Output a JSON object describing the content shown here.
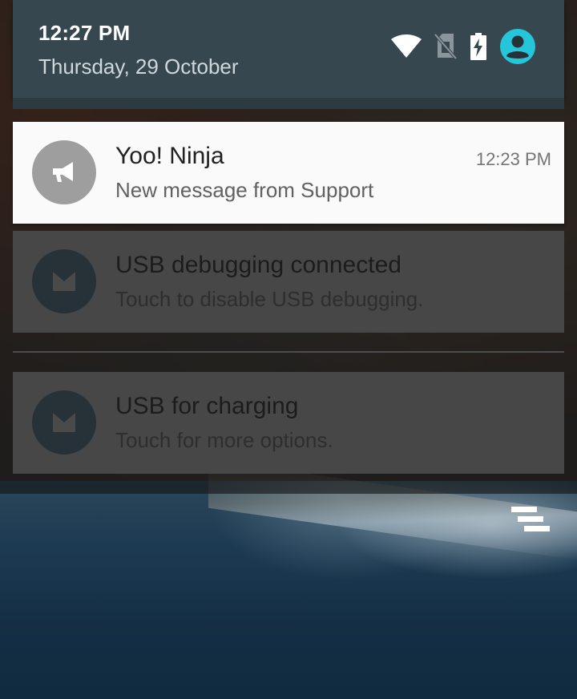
{
  "status": {
    "time": "12:27 PM",
    "date": "Thursday, 29 October",
    "icons": [
      "wifi-icon",
      "no-sim-icon",
      "battery-charging-icon",
      "account-icon"
    ],
    "colors": {
      "header_bg": "#37474f",
      "account_accent": "#26c6da"
    }
  },
  "notifications": [
    {
      "app_icon": "megaphone-icon",
      "title": "Yoo! Ninja",
      "text": "New message from Support",
      "time": "12:23 PM",
      "state": "active"
    },
    {
      "app_icon": "android-system-icon",
      "title": "USB debugging connected",
      "text": "Touch to disable USB debugging.",
      "state": "dimmed"
    },
    {
      "app_icon": "android-system-icon",
      "title": "USB for charging",
      "text": "Touch for more options.",
      "state": "dimmed"
    }
  ],
  "actions": {
    "clear_all_icon": "clear-all-icon"
  }
}
